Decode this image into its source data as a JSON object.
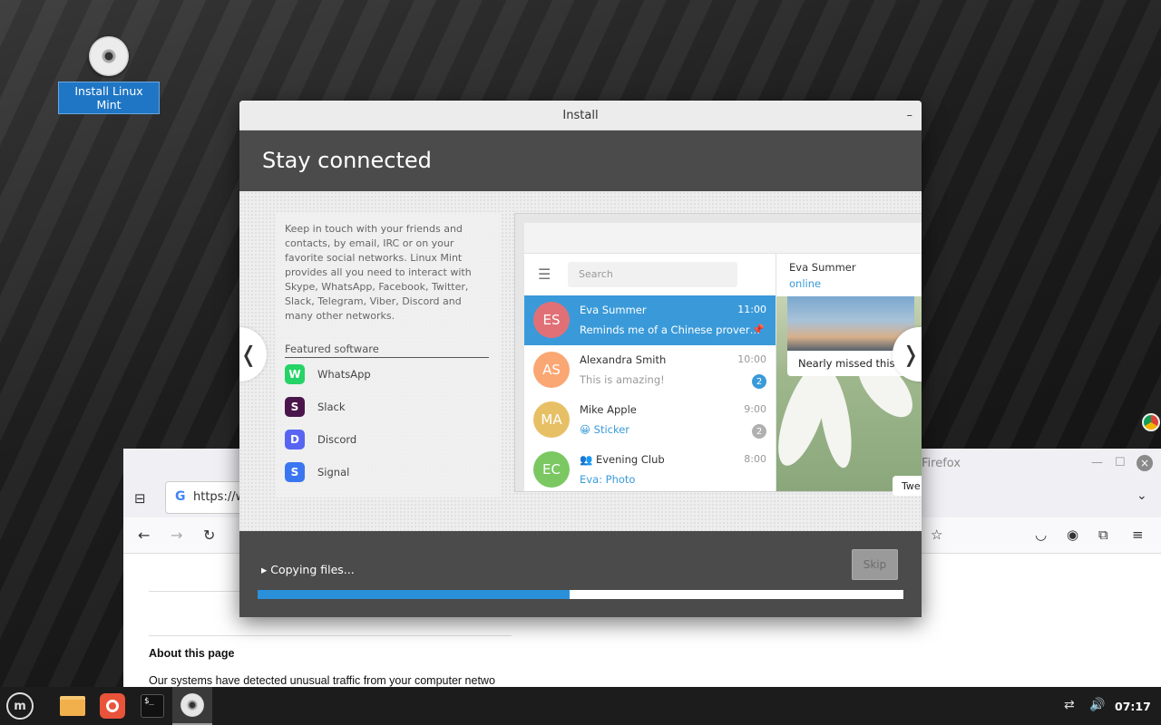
{
  "desktop": {
    "icon_label": "Install Linux Mint"
  },
  "firefox": {
    "title": "Firefox",
    "url": "https://w",
    "about_heading": "About this page",
    "about_text": "Our systems have detected unusual traffic from your computer netwo"
  },
  "install": {
    "window_title": "Install",
    "minimize": "–",
    "heading": "Stay connected",
    "description": "Keep in touch with your friends and contacts, by email, IRC or on your favorite social networks. Linux Mint provides all you need to interact with Skype, WhatsApp, Facebook, Twitter, Slack, Telegram, Viber, Discord and many other networks.",
    "featured_label": "Featured software",
    "apps": [
      {
        "name": "WhatsApp",
        "icon": "whatsapp-icon",
        "color": "#25d366"
      },
      {
        "name": "Slack",
        "icon": "slack-icon",
        "color": "#4a154b"
      },
      {
        "name": "Discord",
        "icon": "discord-icon",
        "color": "#5865f2"
      },
      {
        "name": "Signal",
        "icon": "signal-icon",
        "color": "#3a76f0"
      }
    ],
    "progress_text": "Copying files...",
    "progress": 0.483,
    "skip_label": "Skip",
    "arrow_left": "❬",
    "arrow_right": "❭"
  },
  "telegram": {
    "search_placeholder": "Search",
    "chats": [
      {
        "initials": "ES",
        "name": "Eva Summer",
        "time": "11:00",
        "preview": "Reminds me of a Chinese prover…",
        "color": "#e17076",
        "badge": "",
        "active": true
      },
      {
        "initials": "AS",
        "name": "Alexandra Smith",
        "time": "10:00",
        "preview": "This is amazing!",
        "color": "#faa774",
        "badge": "2",
        "badge_color": "#3a9ad9"
      },
      {
        "initials": "MA",
        "name": "Mike Apple",
        "time": "9:00",
        "preview": "😀 Sticker",
        "color": "#e7c066",
        "badge": "2",
        "badge_color": "#b0b0b0"
      },
      {
        "initials": "EC",
        "name": "Evening Club",
        "time": "8:00",
        "preview": "Eva: Photo",
        "color": "#7bc862",
        "badge": "",
        "group": true
      }
    ],
    "contact_name": "Eva Summer",
    "contact_status": "online",
    "photo_caption": "Nearly missed this s",
    "bubble_text": "Twe"
  },
  "taskbar": {
    "clock": "07:17",
    "menu_label": "m",
    "terminal_label": "$_"
  }
}
